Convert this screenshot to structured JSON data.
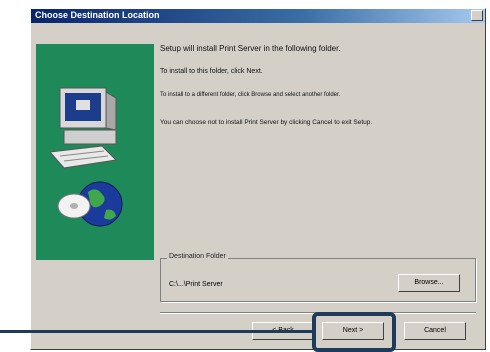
{
  "window": {
    "title": "Choose Destination Location"
  },
  "content": {
    "line1": "Setup will install Print Server in the following folder.",
    "line2": "To install to this folder, click Next.",
    "line3": "To install to a different folder, click Browse and select another folder.",
    "line4": "You can choose not to install Print Server by clicking Cancel to exit Setup."
  },
  "folder": {
    "legend": "Destination Folder",
    "path": "C:\\...\\Print Server"
  },
  "buttons": {
    "browse": "Browse...",
    "back": "< Back",
    "next": "Next >",
    "cancel": "Cancel"
  },
  "colors": {
    "side_panel": "#1e8a5a",
    "callout": "#1f3b5c"
  }
}
